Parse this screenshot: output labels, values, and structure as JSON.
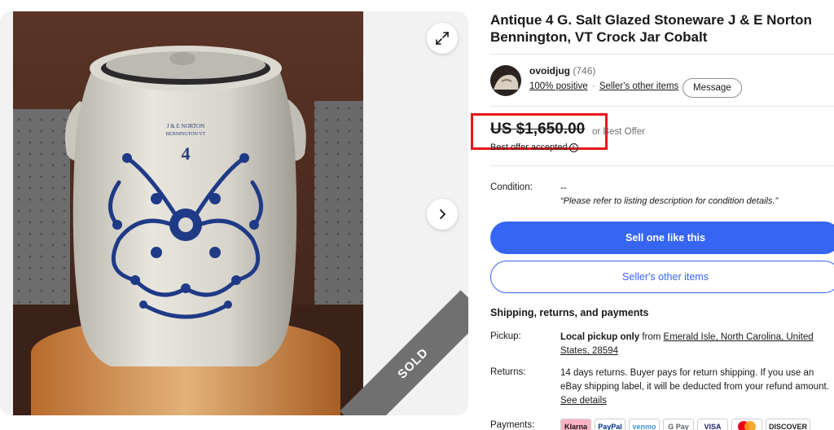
{
  "listing": {
    "title": "Antique 4 G. Salt Glazed Stoneware J & E Norton Bennington, VT Crock Jar Cobalt",
    "sold_label": "SOLD"
  },
  "seller": {
    "name": "ovoidjug",
    "feedback_count": "(746)",
    "positive": "100% positive",
    "separator": "·",
    "other_items_link": "Seller's other items",
    "message_button": "Message"
  },
  "price": {
    "amount": "US $1,650.00",
    "best_offer": "or Best Offer",
    "offer_accepted": "Best offer accepted",
    "info_glyph": "i"
  },
  "condition": {
    "label": "Condition:",
    "value": "--",
    "note": "“Please refer to listing description for condition details.”"
  },
  "actions": {
    "sell_one": "Sell one like this",
    "other_items": "Seller's other items"
  },
  "shipping": {
    "section_title": "Shipping, returns, and payments",
    "pickup_label": "Pickup:",
    "pickup_strong": "Local pickup only",
    "pickup_from": " from ",
    "pickup_location": "Emerald Isle, North Carolina, United States, 28594",
    "returns_label": "Returns:",
    "returns_text": "14 days returns. Buyer pays for return shipping. If you use an eBay shipping label, it will be deducted from your refund amount.",
    "returns_link": "See details",
    "payments_label": "Payments:"
  },
  "payments": [
    {
      "name": "Klarna",
      "color": "#ffb3c7",
      "text_color": "#17120f"
    },
    {
      "name": "PayPal",
      "color": "#ffffff",
      "text_color": "#003087"
    },
    {
      "name": "venmo",
      "color": "#ffffff",
      "text_color": "#3d95ce"
    },
    {
      "name": "G Pay",
      "color": "#ffffff",
      "text_color": "#5f6368"
    },
    {
      "name": "VISA",
      "color": "#ffffff",
      "text_color": "#1a1f71"
    },
    {
      "name": "",
      "color": "#ffffff",
      "text_color": "#eb001b"
    },
    {
      "name": "DISCOVER",
      "color": "#ffffff",
      "text_color": "#231f20"
    }
  ],
  "colors": {
    "accent": "#3665f3",
    "highlight_box": "#e8141b",
    "sold_ribbon": "#707070"
  },
  "icons": {
    "expand": "expand-icon",
    "next": "chevron-right-icon",
    "info": "info-icon"
  }
}
